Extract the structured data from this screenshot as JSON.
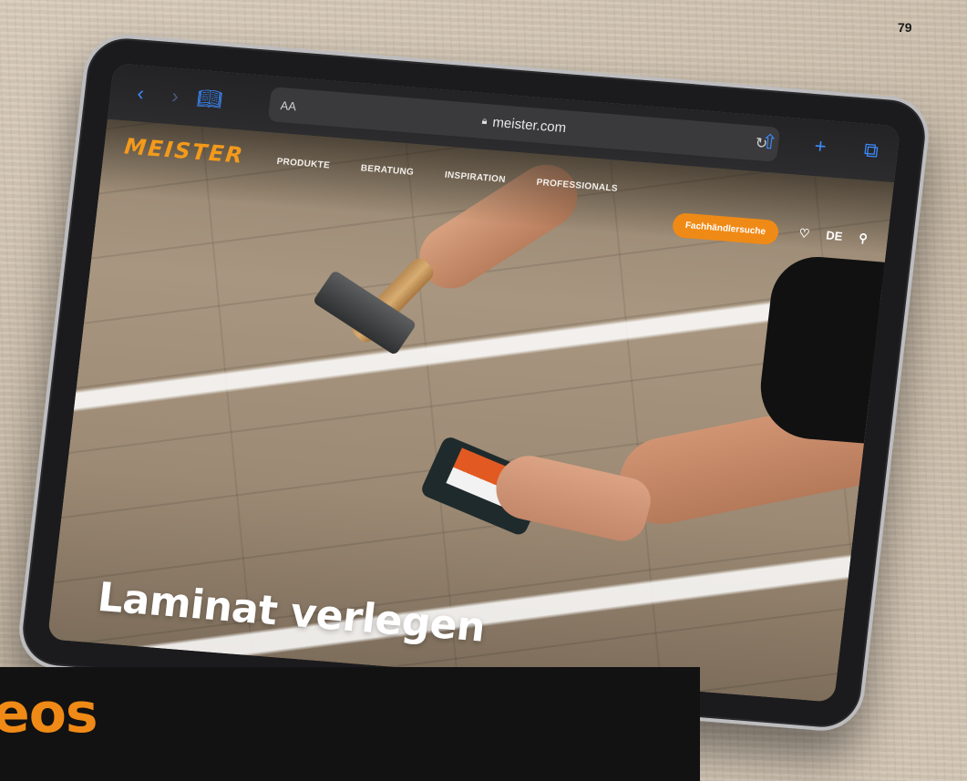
{
  "page_number": "79",
  "safari": {
    "back_icon": "chevron-left-icon",
    "forward_icon": "chevron-right-icon",
    "bookmarks_icon": "book-icon",
    "text_size_label": "AA",
    "url": "meister.com",
    "reload_icon": "reload-icon",
    "share_icon": "share-icon",
    "new_tab_icon": "plus-icon",
    "tabs_icon": "tabs-icon"
  },
  "site": {
    "logo_text": "MEISTER",
    "nav": [
      "PRODUKTE",
      "BERATUNG",
      "INSPIRATION",
      "PROFESSIONALS"
    ],
    "dealer_button": "Fachhändlersuche",
    "language": "DE",
    "hero_title": "Laminat verlegen"
  },
  "bottom_caption": "eos",
  "colors": {
    "accent": "#f08a16",
    "safari_blue": "#3d8bff"
  }
}
